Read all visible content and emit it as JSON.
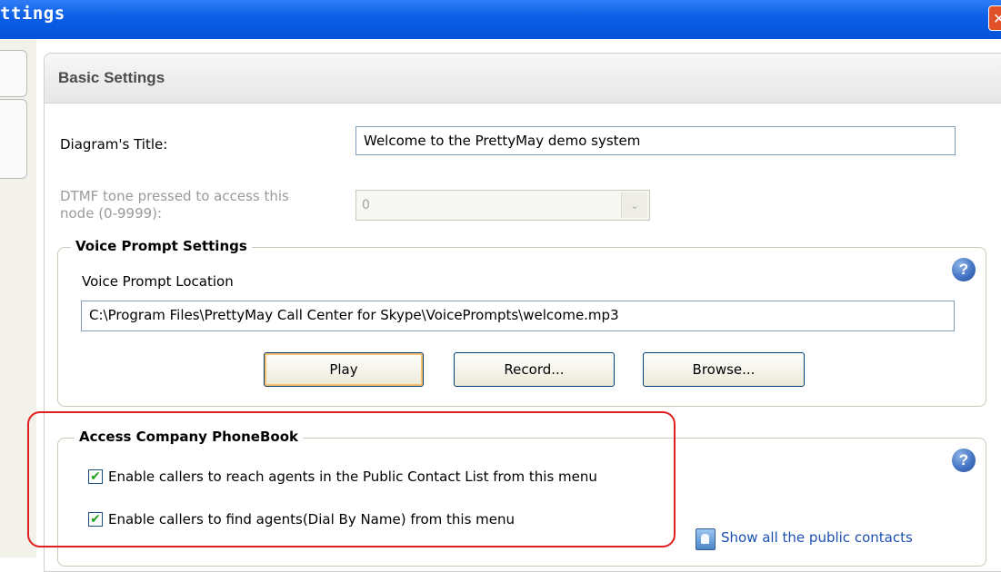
{
  "window": {
    "title": "ttings",
    "close_icon": "close-icon",
    "close_glyph": "✕"
  },
  "panel": {
    "title": "Basic Settings"
  },
  "diagram_title": {
    "label": "Diagram's Title:",
    "value": "Welcome to the PrettyMay demo system"
  },
  "dtmf": {
    "label_line1": "DTMF tone pressed to access this",
    "label_line2": "node (0-9999):",
    "value": "0",
    "arrow_glyph": "⌄"
  },
  "voice_prompt": {
    "legend": "Voice Prompt Settings",
    "location_label": "Voice Prompt Location",
    "location_value": "C:\\Program Files\\PrettyMay Call Center for Skype\\VoicePrompts\\welcome.mp3",
    "help_glyph": "?",
    "buttons": {
      "play": "Play",
      "record": "Record...",
      "browse": "Browse..."
    }
  },
  "phonebook": {
    "legend": "Access Company PhoneBook",
    "help_glyph": "?",
    "options": [
      {
        "label": "Enable callers to reach agents in the Public Contact List from this menu",
        "checked": true,
        "check_glyph": "✔"
      },
      {
        "label": "Enable callers to find agents(Dial By Name) from this menu",
        "checked": true,
        "check_glyph": "✔"
      }
    ],
    "link": "Show all the public contacts"
  },
  "colors": {
    "titlebar": "#0a5fe6",
    "annotation": "#e02020",
    "link": "#1b4fb2",
    "check": "#21a121"
  }
}
